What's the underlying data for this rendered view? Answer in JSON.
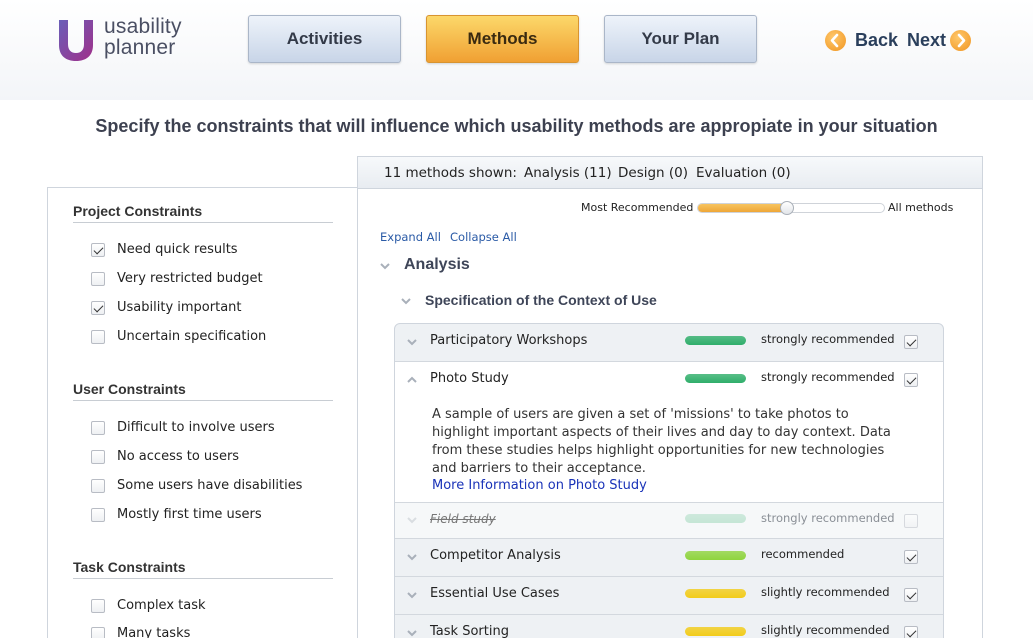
{
  "logo": {
    "line1": "usability",
    "line2": "planner"
  },
  "nav": {
    "tabs": [
      {
        "label": "Activities",
        "active": false
      },
      {
        "label": "Methods",
        "active": true
      },
      {
        "label": "Your Plan",
        "active": false
      }
    ],
    "back": "Back",
    "next": "Next"
  },
  "heading": "Specify the constraints that will influence which usability methods are appropiate in your situation",
  "constraints": {
    "project": {
      "title": "Project Constraints",
      "items": [
        {
          "label": "Need quick results",
          "checked": true
        },
        {
          "label": "Very restricted budget",
          "checked": false
        },
        {
          "label": "Usability important",
          "checked": true
        },
        {
          "label": "Uncertain specification",
          "checked": false
        }
      ]
    },
    "user": {
      "title": "User Constraints",
      "items": [
        {
          "label": "Difficult to involve users",
          "checked": false
        },
        {
          "label": "No access to users",
          "checked": false
        },
        {
          "label": "Some users have disabilities",
          "checked": false
        },
        {
          "label": "Mostly first time users",
          "checked": false
        }
      ]
    },
    "task": {
      "title": "Task Constraints",
      "items": [
        {
          "label": "Complex task",
          "checked": false
        },
        {
          "label": "Many tasks",
          "checked": false
        }
      ]
    }
  },
  "summary": {
    "shown": "11 methods shown:",
    "analysis": "Analysis (11)",
    "design": "Design (0)",
    "evaluation": "Evaluation (0)"
  },
  "slider": {
    "left_label": "Most Recommended",
    "right_label": "All methods",
    "value": 0.48
  },
  "links": {
    "expand": "Expand All",
    "collapse": "Collapse All"
  },
  "analysis_heading": "Analysis",
  "subsection": "Specification of the Context of Use",
  "methods": [
    {
      "name": "Participatory Workshops",
      "rec": "strongly recommended",
      "color": "#2fae6a",
      "checked": true,
      "expanded": false,
      "disabled": false
    },
    {
      "name": "Photo Study",
      "rec": "strongly recommended",
      "color": "#2fae6a",
      "checked": true,
      "expanded": true,
      "disabled": false,
      "description": "A sample of users are given a set of 'missions' to take photos to highlight important aspects of their lives and day to day context. Data from these studies helps highlight opportunities for new technologies and barriers to their acceptance.",
      "more": "More Information on Photo Study"
    },
    {
      "name": "Field study",
      "rec": "strongly recommended",
      "color": "#2fae6a",
      "checked": false,
      "expanded": false,
      "disabled": true
    },
    {
      "name": "Competitor Analysis",
      "rec": "recommended",
      "color": "#8fd43e",
      "checked": true,
      "expanded": false,
      "disabled": false
    },
    {
      "name": "Essential Use Cases",
      "rec": "slightly recommended",
      "color": "#f2cc1a",
      "checked": true,
      "expanded": false,
      "disabled": false
    },
    {
      "name": "Task Sorting",
      "rec": "slightly recommended",
      "color": "#f2cc1a",
      "checked": true,
      "expanded": false,
      "disabled": false
    }
  ]
}
